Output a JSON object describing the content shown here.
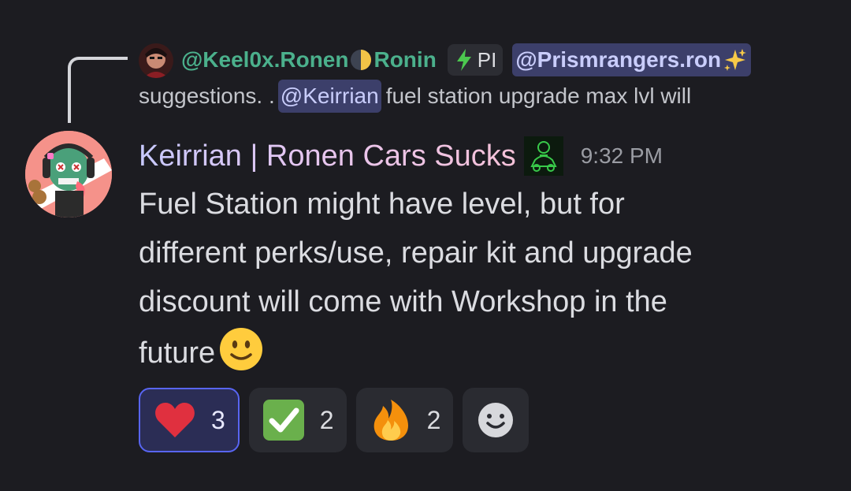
{
  "reply": {
    "author_prefix": "@Keel0x.Ronen",
    "author_suffix": "Ronin",
    "role_tag": "PI",
    "mention": "@Prismrangers.ron",
    "preview_before": "suggestions. .",
    "preview_mention": "@Keirrian",
    "preview_after": "fuel station upgrade max lvl will"
  },
  "message": {
    "username": "Keirrian | Ronen Cars Sucks",
    "timestamp": "9:32 PM",
    "lines": [
      "Fuel Station might have level, but for",
      "different perks/use, repair kit and upgrade",
      "discount will come with Workshop in the",
      "future"
    ]
  },
  "reactions": [
    {
      "emoji": "red-heart",
      "count": "3",
      "active": true
    },
    {
      "emoji": "check-mark-button",
      "count": "2",
      "active": false
    },
    {
      "emoji": "fire",
      "count": "2",
      "active": false
    }
  ],
  "colors": {
    "background": "#1c1c21",
    "reply_author": "#4bb08c",
    "mention_bg": "#3c3f6a",
    "mention_text": "#c9cdfb",
    "active_reaction_border": "#5865f2",
    "timestamp": "#9a9ca3"
  }
}
